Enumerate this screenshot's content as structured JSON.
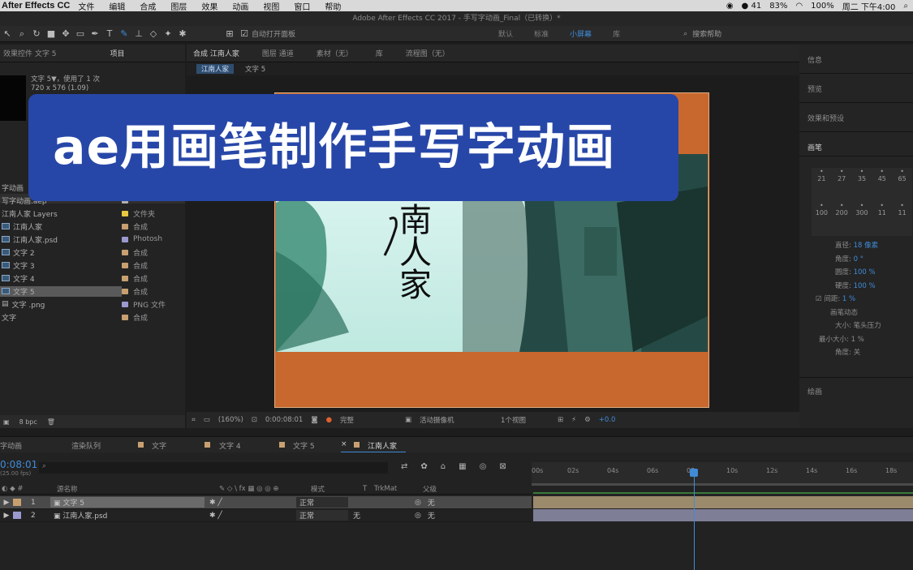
{
  "menubar": {
    "app": "After Effects CC",
    "items": [
      "文件",
      "编辑",
      "合成",
      "图层",
      "效果",
      "动画",
      "视图",
      "窗口",
      "帮助"
    ],
    "right": {
      "notif": "41",
      "battery_small": "83%",
      "battery": "100%",
      "clock": "周二 下午4:00"
    }
  },
  "window": {
    "title": "Adobe After Effects CC 2017 - 手写字动画_Final（已转换）*"
  },
  "toolbar": {
    "auto_open": "自动打开面板",
    "workspaces": [
      "默认",
      "标准",
      "小屏幕",
      "库"
    ],
    "active_workspace": "小屏幕",
    "search": "搜索帮助"
  },
  "project": {
    "tabs": [
      "效果控件 文字 5",
      "项目"
    ],
    "info_line1": "文字 5▼，使用了 1 次",
    "info_line2": "720 x 576 (1.09)",
    "rows": [
      {
        "name": "字动画",
        "type": "",
        "label": "#b0b0b0"
      },
      {
        "name": "写字动画.aep",
        "type": "",
        "label": "#b0b0b0"
      },
      {
        "name": "江南人家 Layers",
        "type": "文件夹",
        "label": "#e8c840"
      },
      {
        "name": "江南人家",
        "type": "合成",
        "label": "#c8a070"
      },
      {
        "name": "江南人家.psd",
        "type": "Photosh",
        "label": "#9a9ad0"
      },
      {
        "name": "文字 2",
        "type": "合成",
        "label": "#c8a070"
      },
      {
        "name": "文字 3",
        "type": "合成",
        "label": "#c8a070"
      },
      {
        "name": "文字 4",
        "type": "合成",
        "label": "#c8a070"
      },
      {
        "name": "文字 5",
        "type": "合成",
        "label": "#c8a070"
      },
      {
        "name": "文字 .png",
        "type": "PNG 文件",
        "label": "#9a9ad0"
      },
      {
        "name": "文字",
        "type": "合成",
        "label": "#c8a070"
      }
    ],
    "footer": "8 bpc"
  },
  "viewer": {
    "tabs": [
      "合成 江南人家",
      "图层 通道",
      "素材（无）",
      "库",
      "流程图（无）"
    ],
    "breadcrumbs": [
      "江南人家",
      "文字 5"
    ],
    "zoom": "(160%)",
    "timecode": "0:00:08:01",
    "quality": "完整",
    "camera": "活动摄像机",
    "views": "1个视图",
    "exposure": "+0.0"
  },
  "scene": {
    "calligraphy": "南人家"
  },
  "right_panel": {
    "sections": [
      "信息",
      "预览",
      "效果和预设",
      "画笔",
      "绘画"
    ],
    "brush_sizes": [
      "21",
      "27",
      "35",
      "45",
      "65",
      "100",
      "200",
      "300",
      "11",
      "11"
    ],
    "brush_props": [
      {
        "k": "直径:",
        "v": "18 像素"
      },
      {
        "k": "角度:",
        "v": "0 °"
      },
      {
        "k": "圆度:",
        "v": "100 %"
      },
      {
        "k": "硬度:",
        "v": "100 %"
      },
      {
        "k": "间距:",
        "v": "1 %"
      }
    ],
    "dynamics": "画笔动态",
    "size_label": "大小:",
    "size_val": "笔头压力",
    "min_size_label": "最小大小:",
    "min_size": "1 %",
    "angle_label": "角度:",
    "angle_val": "关"
  },
  "timeline": {
    "tabs": [
      "字动画",
      "渲染队列",
      "文字",
      "文字 4",
      "文字 5",
      "江南人家"
    ],
    "timecode": "0:08:01",
    "fps": "(25.00 fps)",
    "columns": [
      "源名称",
      "模式",
      "T",
      "TrkMat",
      "父级"
    ],
    "ticks": [
      "00s",
      "02s",
      "04s",
      "06s",
      "08s",
      "10s",
      "12s",
      "14s",
      "16s",
      "18s"
    ],
    "layers": [
      {
        "num": "1",
        "name": "文字 5",
        "mode": "正常",
        "trkmat": "",
        "parent": "无",
        "label": "#c8a070"
      },
      {
        "num": "2",
        "name": "江南人家.psd",
        "mode": "正常",
        "trkmat": "无",
        "parent": "无",
        "label": "#9a9ad0"
      }
    ]
  },
  "overlay": {
    "title": "ae用画笔制作手写字动画"
  },
  "colors": {
    "overlay": "#2747a8",
    "accent": "#3f8bd8",
    "comp_bg": "#c8672e"
  }
}
